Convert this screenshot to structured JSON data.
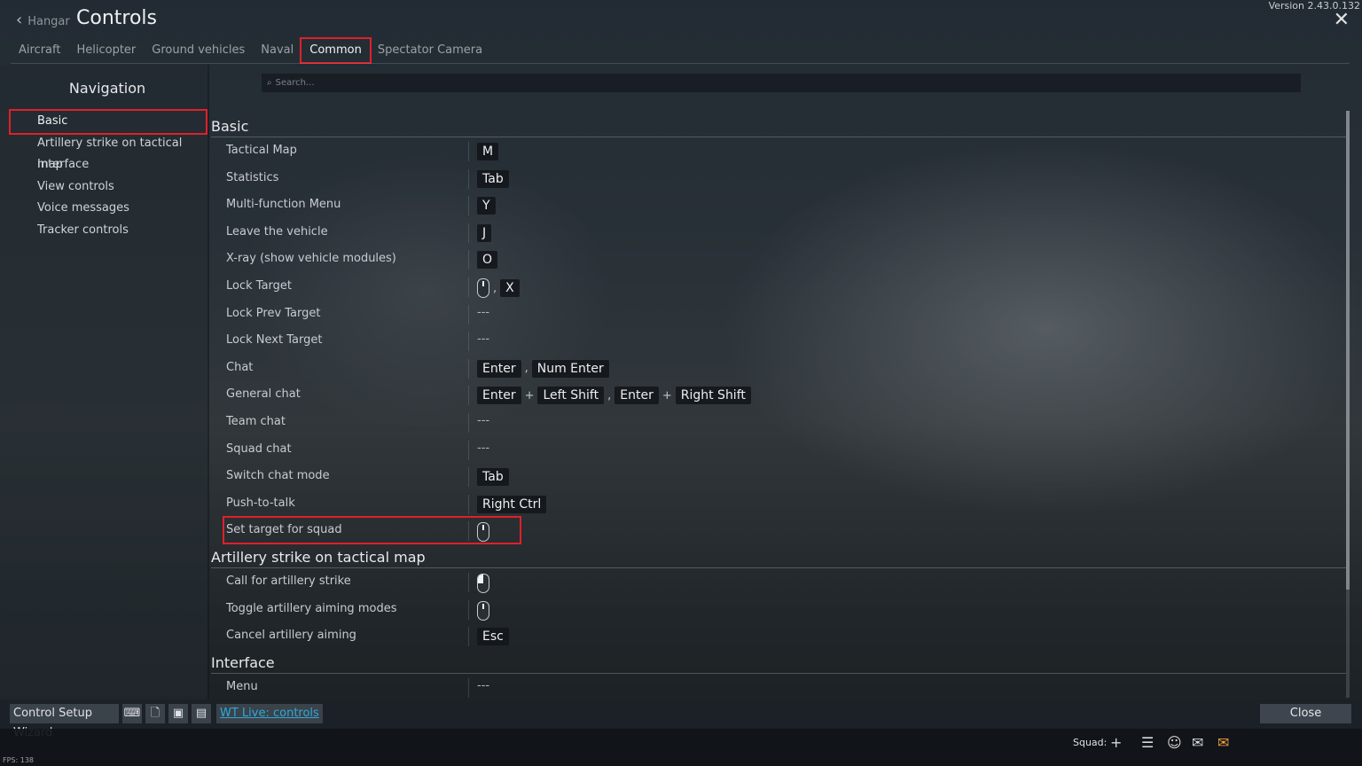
{
  "header": {
    "version": "Version 2.43.0.132",
    "back_label": "Hangar",
    "title": "Controls"
  },
  "tabs": [
    "Aircraft",
    "Helicopter",
    "Ground vehicles",
    "Naval",
    "Common",
    "Spectator Camera"
  ],
  "active_tab": "Common",
  "navigation": {
    "title": "Navigation",
    "items": [
      "Basic",
      "Artillery strike on tactical map",
      "Interface",
      "View controls",
      "Voice messages",
      "Tracker controls"
    ],
    "selected": "Basic"
  },
  "search": {
    "placeholder": "Search..."
  },
  "sections": [
    {
      "title": "Basic",
      "rows": [
        {
          "label": "Tactical Map",
          "keys": [
            [
              "M"
            ]
          ]
        },
        {
          "label": "Statistics",
          "keys": [
            [
              "Tab"
            ]
          ]
        },
        {
          "label": "Multi-function Menu",
          "keys": [
            [
              "Y"
            ]
          ]
        },
        {
          "label": "Leave the vehicle",
          "keys": [
            [
              "J"
            ]
          ]
        },
        {
          "label": "X-ray (show vehicle modules)",
          "keys": [
            [
              "O"
            ]
          ]
        },
        {
          "label": "Lock Target",
          "keys": [
            [
              "mouse-middle-icon"
            ],
            [
              "X"
            ]
          ]
        },
        {
          "label": "Lock Prev Target",
          "keys": []
        },
        {
          "label": "Lock Next Target",
          "keys": []
        },
        {
          "label": "Chat",
          "keys": [
            [
              "Enter"
            ],
            [
              "Num Enter"
            ]
          ]
        },
        {
          "label": "General chat",
          "keys": [
            [
              "Enter",
              "Left Shift"
            ],
            [
              "Enter",
              "Right Shift"
            ]
          ]
        },
        {
          "label": "Team chat",
          "keys": []
        },
        {
          "label": "Squad chat",
          "keys": []
        },
        {
          "label": "Switch chat mode",
          "keys": [
            [
              "Tab"
            ]
          ]
        },
        {
          "label": "Push-to-talk",
          "keys": [
            [
              "Right Ctrl"
            ]
          ]
        },
        {
          "label": "Set target for squad",
          "keys": [
            [
              "mouse-middle-icon"
            ]
          ]
        }
      ]
    },
    {
      "title": "Artillery strike on tactical map",
      "rows": [
        {
          "label": "Call for artillery strike",
          "keys": [
            [
              "mouse-left-icon"
            ]
          ]
        },
        {
          "label": "Toggle artillery aiming modes",
          "keys": [
            [
              "mouse-middle-icon"
            ]
          ]
        },
        {
          "label": "Cancel artillery aiming",
          "keys": [
            [
              "Esc"
            ]
          ]
        }
      ]
    },
    {
      "title": "Interface",
      "rows": [
        {
          "label": "Menu",
          "keys": []
        }
      ]
    }
  ],
  "empty_binding": "---",
  "combo_separator": "+",
  "alt_separator": ",",
  "footer": {
    "wizard_label": "Control Setup Wizard",
    "icon_buttons": [
      "keyboard-icon",
      "new-file-icon",
      "save-icon",
      "open-folder-icon"
    ],
    "wt_live_label": "WT Live: controls",
    "close_label": "Close"
  },
  "statusbar": {
    "squad_label": "Squad:",
    "fps": "FPS: 138"
  },
  "colors": {
    "highlight": "#e0202a",
    "link": "#30a8d8"
  }
}
